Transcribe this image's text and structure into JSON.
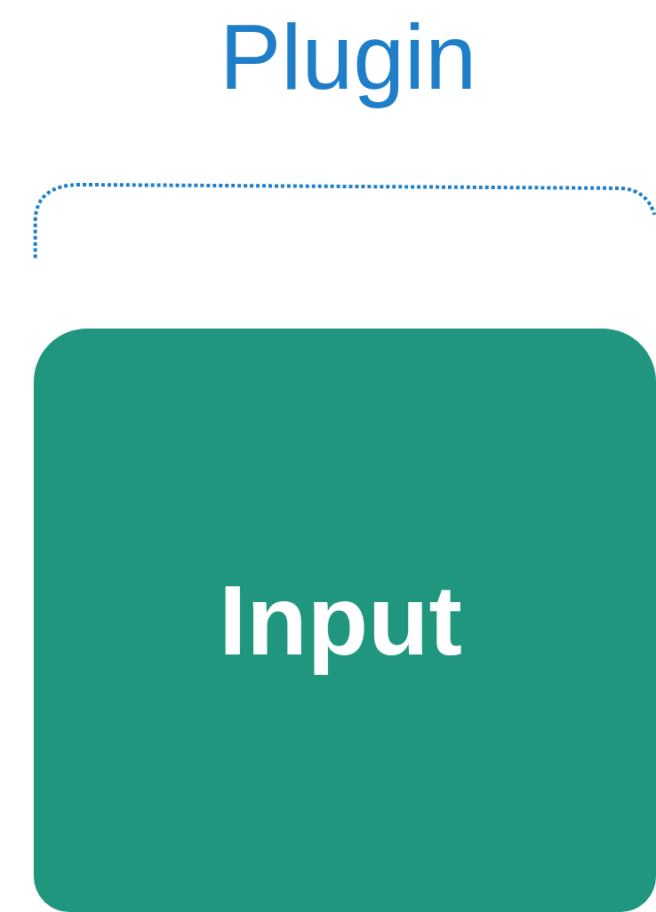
{
  "diagram": {
    "title": "Plugin",
    "nodes": [
      {
        "label": "Input"
      }
    ]
  }
}
